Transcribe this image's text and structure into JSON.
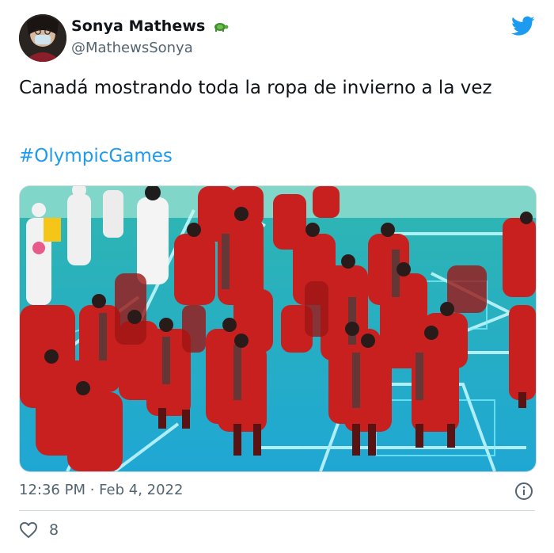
{
  "author": {
    "display_name": "Sonya Mathews",
    "handle": "@MathewsSonya",
    "badge_emoji": "🐢"
  },
  "tweet": {
    "text": "Canadá mostrando toda la ropa de invierno a la vez",
    "hashtag": "#OlympicGames",
    "media_icon": "photo",
    "timestamp": "12:36 PM · Feb 4, 2022"
  },
  "engagement": {
    "like_count": "8"
  },
  "colors": {
    "accent": "#1d9bf0",
    "secondary_text": "#536471",
    "coat_red": "#c8201f",
    "floor_teal": "#2bc6c6"
  },
  "icons": {
    "brand": "twitter-bird-icon",
    "info": "info-icon",
    "like": "heart-icon"
  }
}
